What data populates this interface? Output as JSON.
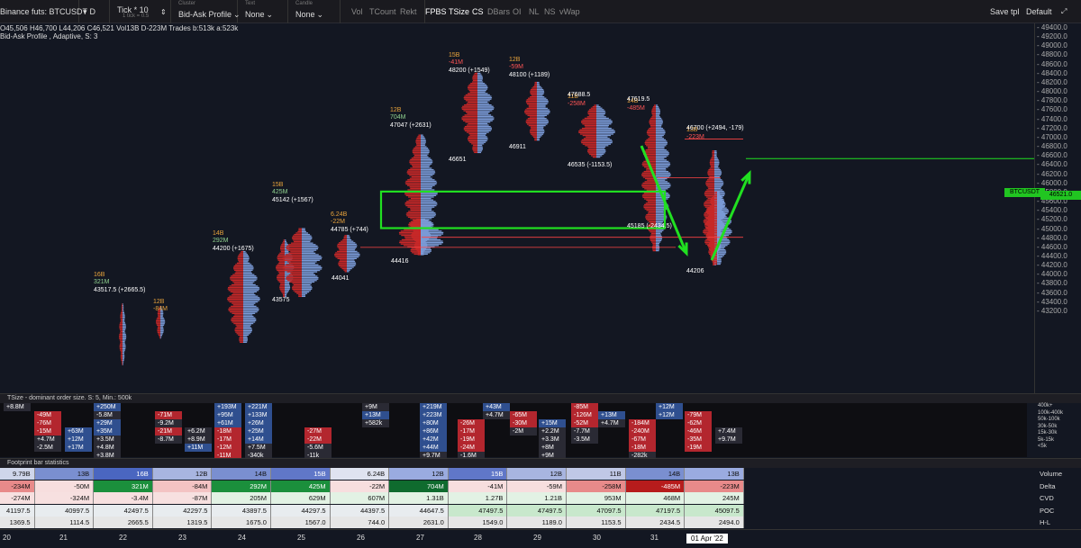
{
  "toolbar": {
    "symbol": "Binance futs: BTCUSDT",
    "timeframe": "D",
    "tick_title": "Tick * 10",
    "tick_sub": "1 tick = 0.5",
    "cluster_title": "Cluster",
    "cluster_value": "Bid-Ask Profile",
    "text_title": "Text",
    "text_value": "None",
    "candle_title": "Candle",
    "candle_value": "None",
    "buttons": [
      "Vol",
      "TCount",
      "Rekt",
      "FPBS",
      "TSize",
      "CS",
      "DBars",
      "OI",
      "NL",
      "NS",
      "vWap"
    ],
    "save_tpl": "Save tpl",
    "default": "Default"
  },
  "ohlc": {
    "o": "45,506",
    "h": "46,700",
    "l": "44,206",
    "c": "46,521",
    "vol": "13B",
    "d": "-223M",
    "trades": "Trades b:513k a:523k",
    "profile": "Bid-Ask Profile , Adaptive, S: 3"
  },
  "y_ticks": [
    "49400.0",
    "49200.0",
    "49000.0",
    "48800.0",
    "48600.0",
    "48400.0",
    "48200.0",
    "48000.0",
    "47800.0",
    "47600.0",
    "47400.0",
    "47200.0",
    "47000.0",
    "46800.0",
    "46600.0",
    "46400.0",
    "46200.0",
    "46000.0",
    "45800.0",
    "45600.0",
    "45400.0",
    "45200.0",
    "45000.0",
    "44800.0",
    "44600.0",
    "44400.0",
    "44200.0",
    "44000.0",
    "43800.0",
    "43600.0",
    "43400.0",
    "43200.0"
  ],
  "price_tag": {
    "symbol": "BTCUSDT",
    "price": "46521.0"
  },
  "accent": {
    "bid": "#c62828",
    "ask": "#7a9ad6",
    "green": "#21e021",
    "line": "#ff4444"
  },
  "bars": [
    {
      "vol": "16B",
      "delta": "321M",
      "dcolor": "gr",
      "poc": "43517.5 (+2665.5)"
    },
    {
      "vol": "12B",
      "delta": "-84M",
      "dcolor": "or"
    },
    {
      "vol": "14B",
      "delta": "292M",
      "dcolor": "gr",
      "poc": "44200 (+1675)"
    },
    {
      "vol": "",
      "delta": "",
      "dcolor": "",
      "low": "43575"
    },
    {
      "vol": "15B",
      "delta": "425M",
      "dcolor": "gr",
      "poc": "45142 (+1567)"
    },
    {
      "vol": "6.24B",
      "delta": "-22M",
      "dcolor": "or",
      "poc": "44785 (+744)",
      "low": "44041"
    },
    {
      "vol": "12B",
      "delta": "704M",
      "dcolor": "gr",
      "poc": "47047 (+2631)",
      "low": "44416"
    },
    {
      "vol": "15B",
      "delta": "-41M",
      "dcolor": "rd",
      "poc": "48200 (+1549)",
      "low": "46651"
    },
    {
      "vol": "12B",
      "delta": "-59M",
      "dcolor": "rd",
      "poc": "48100 (+1189)",
      "low": "46911"
    },
    {
      "vol": "11B",
      "delta": "-258M",
      "dcolor": "rd",
      "poc": "47688.5",
      "low": "46535 (-1153.5)"
    },
    {
      "vol": "14B",
      "delta": "-485M",
      "dcolor": "rd",
      "poc": "47619.5",
      "low": "45185 (-2434.5)"
    },
    {
      "vol": "13B",
      "delta": "-223M",
      "dcolor": "rd",
      "poc": "46700 (+2494, -179)",
      "low": "44206"
    }
  ],
  "tsize": {
    "header": "TSize - dominant order size. S: 5, Min.: 500k",
    "legend": [
      "400k+",
      "100k-400k",
      "50k-100k",
      "30k-50k",
      "15k-30k",
      "5k-15k",
      "<5k"
    ],
    "cols": [
      [
        "+8.8M"
      ],
      [
        "-49M",
        "-76M",
        "-15M",
        "+4.7M",
        "-2.5M"
      ],
      [
        "+63M",
        "+12M",
        "+17M"
      ],
      [
        "+250M",
        "-5.8M",
        "+29M",
        "+35M",
        "+3.5M",
        "+4.8M",
        "+3.8M"
      ],
      [
        "-71M",
        "-9.2M",
        "-21M",
        "-8.7M"
      ],
      [
        "+6.2M",
        "+8.9M",
        "+11M"
      ],
      [
        "+193M",
        "+95M",
        "+61M",
        "-18M",
        "-17M",
        "-12M",
        "-11M"
      ],
      [
        "+221M",
        "+133M",
        "+26M",
        "+25M",
        "+14M",
        "+7.5M",
        "-340k"
      ],
      [
        "-27M",
        "-22M",
        "-5.6M",
        "-11k"
      ],
      [
        "+9M",
        "+13M",
        "+582k"
      ],
      [
        "+219M",
        "+223M",
        "+80M",
        "+86M",
        "+42M",
        "+44M",
        "+9.7M"
      ],
      [
        "-26M",
        "-17M",
        "-19M",
        "-24M",
        "-1.6M"
      ],
      [
        "+43M",
        "+4.7M"
      ],
      [
        "-65M",
        "-30M",
        "-2M"
      ],
      [
        "+15M",
        "+2.2M",
        "+3.3M",
        "+8M",
        "+9M"
      ],
      [
        "-85M",
        "-126M",
        "-52M",
        "-7.7M",
        "-3.5M"
      ],
      [
        "+13M",
        "+4.7M"
      ],
      [
        "-184M",
        "-240M",
        "-67M",
        "-18M",
        "-282k"
      ],
      [
        "+12M",
        "+12M"
      ],
      [
        "-79M",
        "-62M",
        "-46M",
        "-35M",
        "-19M"
      ],
      [
        "+7.4M",
        "+9.7M"
      ]
    ]
  },
  "footprint": {
    "header": "Footprint bar statistics",
    "row_labels": [
      "Volume",
      "Delta",
      "CVD",
      "POC",
      "H-L"
    ],
    "volume": [
      "9.79B",
      "13B",
      "16B",
      "12B",
      "14B",
      "15B",
      "6.24B",
      "12B",
      "15B",
      "12B",
      "11B",
      "14B",
      "13B"
    ],
    "delta": [
      "-234M",
      "-50M",
      "321M",
      "-84M",
      "292M",
      "425M",
      "-22M",
      "704M",
      "-41M",
      "-59M",
      "-258M",
      "-485M",
      "-223M"
    ],
    "cvd": [
      "-274M",
      "-324M",
      "-3.4M",
      "-87M",
      "205M",
      "629M",
      "607M",
      "1.31B",
      "1.27B",
      "1.21B",
      "953M",
      "468M",
      "245M"
    ],
    "poc": [
      "41197.5",
      "40997.5",
      "42497.5",
      "42297.5",
      "43897.5",
      "44297.5",
      "44397.5",
      "44647.5",
      "47497.5",
      "47497.5",
      "47097.5",
      "47197.5",
      "45097.5"
    ],
    "hl": [
      "1369.5",
      "1114.5",
      "2665.5",
      "1319.5",
      "1675.0",
      "1567.0",
      "744.0",
      "2631.0",
      "1549.0",
      "1189.0",
      "1153.5",
      "2434.5",
      "2494.0"
    ]
  },
  "x_labels": [
    "20",
    "21",
    "22",
    "23",
    "24",
    "25",
    "26",
    "27",
    "28",
    "29",
    "30",
    "31",
    "01 Apr '22"
  ]
}
